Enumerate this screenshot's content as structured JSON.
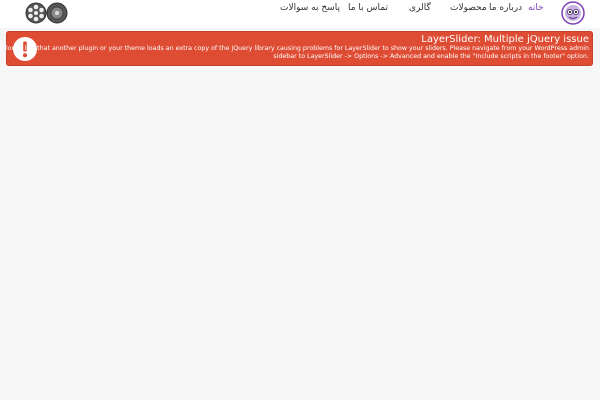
{
  "header": {
    "left_logo_icon": "film-reels-icon",
    "right_logo_icon": "character-face-logo",
    "nav": [
      {
        "label": "خانه",
        "active": true
      },
      {
        "label": "درباره ما",
        "active": false
      },
      {
        "label": "محصولات",
        "active": false
      },
      {
        "label": "گالری",
        "active": false
      },
      {
        "label": "تماس با ما",
        "active": false
      },
      {
        "label": "پاسخ به سوالات",
        "active": false
      }
    ]
  },
  "alert": {
    "icon": "exclamation-icon",
    "title": "LayerSlider: Multiple jQuery issue",
    "line1": "It looks like that another plugin or your theme loads an extra copy of the jQuery library causing problems for LayerSlider to show your sliders. Please navigate from your WordPress admin",
    "line2": "sidebar to LayerSlider -> Options -> Advanced and enable the \"Include scripts in the footer\" option.",
    "color": "#de4c34"
  },
  "colors": {
    "active_nav": "#7b3fb3",
    "background": "#f6f6f6"
  }
}
